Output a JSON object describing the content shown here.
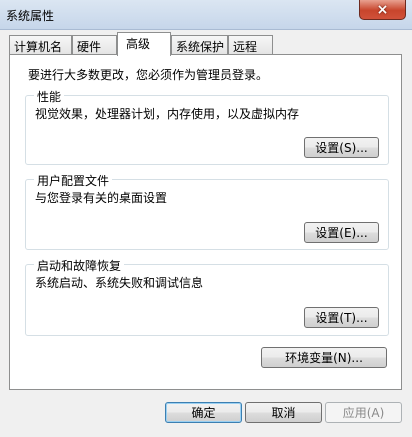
{
  "window": {
    "title": "系统属性",
    "close_glyph": "×"
  },
  "tabs": [
    {
      "label": "计算机名"
    },
    {
      "label": "硬件"
    },
    {
      "label": "高级"
    },
    {
      "label": "系统保护"
    },
    {
      "label": "远程"
    }
  ],
  "intro": "要进行大多数更改，您必须作为管理员登录。",
  "groups": {
    "performance": {
      "legend": "性能",
      "desc": "视觉效果，处理器计划，内存使用，以及虚拟内存",
      "button": "设置(S)..."
    },
    "user_profiles": {
      "legend": "用户配置文件",
      "desc": "与您登录有关的桌面设置",
      "button": "设置(E)..."
    },
    "startup_recovery": {
      "legend": "启动和故障恢复",
      "desc": "系统启动、系统失败和调试信息",
      "button": "设置(T)..."
    }
  },
  "env_button": "环境变量(N)...",
  "footer": {
    "ok": "确定",
    "cancel": "取消",
    "apply": "应用(A)"
  }
}
